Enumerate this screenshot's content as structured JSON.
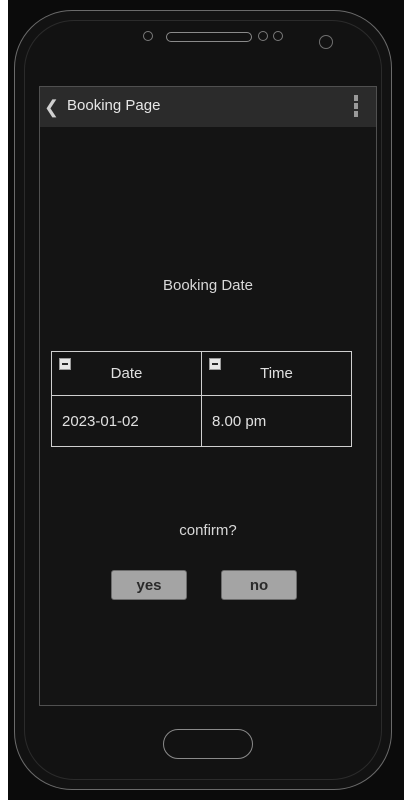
{
  "header": {
    "title": "Booking Page"
  },
  "icons": {
    "back": "chevron-left-icon",
    "menu": "vertical-ellipsis-icon",
    "collapse": "minus-box-icon"
  },
  "content": {
    "heading": "Booking Date",
    "table": {
      "columns": [
        "Date",
        "Time"
      ],
      "rows": [
        [
          "2023-01-02",
          "8.00 pm"
        ]
      ]
    },
    "confirm_prompt": "confirm?"
  },
  "actions": {
    "yes_label": "yes",
    "no_label": "no"
  },
  "colors": {
    "background": "#141414",
    "titlebar": "#2b2b2b",
    "button": "#a4a4a4",
    "text": "#e0e0e0"
  }
}
